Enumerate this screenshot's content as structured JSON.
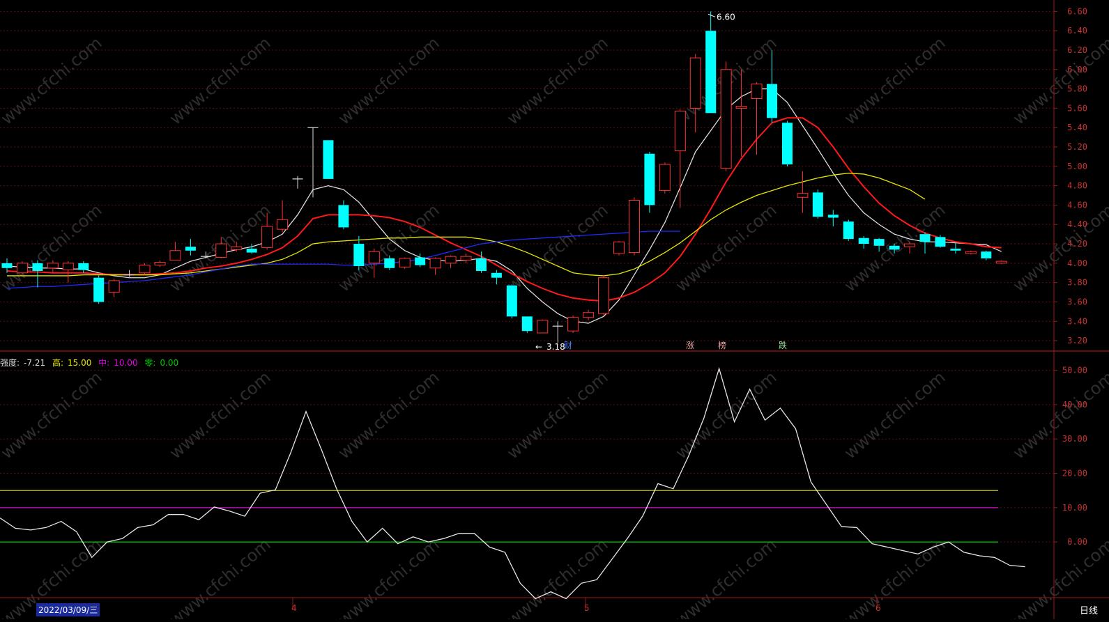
{
  "chart_data": {
    "type": "candlestick",
    "price_axis": {
      "ticks": [
        "6.60",
        "6.40",
        "6.20",
        "6.00",
        "5.80",
        "5.60",
        "5.40",
        "5.20",
        "5.00",
        "4.80",
        "4.60",
        "4.40",
        "4.20",
        "4.00",
        "3.80",
        "3.60",
        "3.40",
        "3.20"
      ],
      "range": [
        3.1,
        6.66
      ]
    },
    "candles": [
      {
        "o": 4.0,
        "c": 3.95,
        "h": 4.05,
        "l": 3.9
      },
      {
        "o": 3.9,
        "c": 4.0,
        "h": 4.02,
        "l": 3.88
      },
      {
        "o": 4.0,
        "c": 3.92,
        "h": 4.03,
        "l": 3.75
      },
      {
        "o": 3.95,
        "c": 4.0,
        "h": 4.03,
        "l": 3.9
      },
      {
        "o": 3.93,
        "c": 4.0,
        "h": 4.02,
        "l": 3.8
      },
      {
        "o": 4.0,
        "c": 3.93,
        "h": 4.02,
        "l": 3.9
      },
      {
        "o": 3.85,
        "c": 3.6,
        "h": 3.88,
        "l": 3.58
      },
      {
        "o": 3.7,
        "c": 3.82,
        "h": 3.84,
        "l": 3.65
      },
      {
        "o": 3.88,
        "c": 3.88,
        "h": 3.93,
        "l": 3.86
      },
      {
        "o": 3.9,
        "c": 3.98,
        "h": 4.0,
        "l": 3.88
      },
      {
        "o": 3.98,
        "c": 4.01,
        "h": 4.03,
        "l": 3.96
      },
      {
        "o": 4.03,
        "c": 4.13,
        "h": 4.22,
        "l": 4.03
      },
      {
        "o": 4.17,
        "c": 4.13,
        "h": 4.25,
        "l": 4.08
      },
      {
        "o": 4.07,
        "c": 4.07,
        "h": 4.12,
        "l": 4.05
      },
      {
        "o": 4.06,
        "c": 4.2,
        "h": 4.27,
        "l": 4.05
      },
      {
        "o": 4.14,
        "c": 4.17,
        "h": 4.22,
        "l": 4.12
      },
      {
        "o": 4.15,
        "c": 4.11,
        "h": 4.2,
        "l": 4.1
      },
      {
        "o": 4.16,
        "c": 4.38,
        "h": 4.52,
        "l": 4.14
      },
      {
        "o": 4.35,
        "c": 4.45,
        "h": 4.65,
        "l": 4.32
      },
      {
        "o": 4.87,
        "c": 4.87,
        "h": 4.9,
        "l": 4.77
      },
      {
        "o": 5.4,
        "c": 5.4,
        "h": 5.4,
        "l": 4.68
      },
      {
        "o": 5.27,
        "c": 4.87,
        "h": 5.27,
        "l": 4.87
      },
      {
        "o": 4.6,
        "c": 4.37,
        "h": 4.65,
        "l": 4.35
      },
      {
        "o": 4.2,
        "c": 3.97,
        "h": 4.28,
        "l": 3.93
      },
      {
        "o": 4.0,
        "c": 4.12,
        "h": 4.15,
        "l": 3.85
      },
      {
        "o": 4.05,
        "c": 3.95,
        "h": 4.08,
        "l": 3.93
      },
      {
        "o": 3.96,
        "c": 4.05,
        "h": 4.06,
        "l": 3.94
      },
      {
        "o": 4.06,
        "c": 3.98,
        "h": 4.1,
        "l": 3.96
      },
      {
        "o": 3.95,
        "c": 4.05,
        "h": 4.06,
        "l": 3.88
      },
      {
        "o": 4.0,
        "c": 4.07,
        "h": 4.08,
        "l": 3.95
      },
      {
        "o": 4.03,
        "c": 4.07,
        "h": 4.1,
        "l": 4.0
      },
      {
        "o": 4.05,
        "c": 3.92,
        "h": 4.12,
        "l": 3.9
      },
      {
        "o": 3.9,
        "c": 3.85,
        "h": 3.93,
        "l": 3.78
      },
      {
        "o": 3.77,
        "c": 3.45,
        "h": 3.78,
        "l": 3.43
      },
      {
        "o": 3.45,
        "c": 3.3,
        "h": 3.45,
        "l": 3.28
      },
      {
        "o": 3.28,
        "c": 3.41,
        "h": 3.42,
        "l": 3.28
      },
      {
        "o": 3.35,
        "c": 3.35,
        "h": 3.4,
        "l": 3.18
      },
      {
        "o": 3.3,
        "c": 3.44,
        "h": 3.46,
        "l": 3.28
      },
      {
        "o": 3.44,
        "c": 3.49,
        "h": 3.52,
        "l": 3.41
      },
      {
        "o": 3.48,
        "c": 3.85,
        "h": 3.88,
        "l": 3.45
      },
      {
        "o": 4.1,
        "c": 4.22,
        "h": 4.23,
        "l": 4.08
      },
      {
        "o": 4.11,
        "c": 4.65,
        "h": 4.68,
        "l": 4.08
      },
      {
        "o": 5.13,
        "c": 4.6,
        "h": 5.15,
        "l": 4.52
      },
      {
        "o": 4.75,
        "c": 5.02,
        "h": 5.04,
        "l": 4.72
      },
      {
        "o": 5.16,
        "c": 5.57,
        "h": 5.59,
        "l": 4.57
      },
      {
        "o": 5.6,
        "c": 6.12,
        "h": 6.16,
        "l": 5.35
      },
      {
        "o": 6.4,
        "c": 5.55,
        "h": 6.6,
        "l": 5.55
      },
      {
        "o": 4.98,
        "c": 6.0,
        "h": 6.08,
        "l": 4.95
      },
      {
        "o": 5.6,
        "c": 5.62,
        "h": 6.0,
        "l": 5.1
      },
      {
        "o": 5.7,
        "c": 5.85,
        "h": 5.87,
        "l": 5.12
      },
      {
        "o": 5.85,
        "c": 5.5,
        "h": 6.2,
        "l": 5.45
      },
      {
        "o": 5.45,
        "c": 5.02,
        "h": 5.47,
        "l": 5.0
      },
      {
        "o": 4.68,
        "c": 4.72,
        "h": 4.95,
        "l": 4.52
      },
      {
        "o": 4.73,
        "c": 4.48,
        "h": 4.76,
        "l": 4.46
      },
      {
        "o": 4.5,
        "c": 4.47,
        "h": 4.55,
        "l": 4.38
      },
      {
        "o": 4.43,
        "c": 4.25,
        "h": 4.45,
        "l": 4.23
      },
      {
        "o": 4.26,
        "c": 4.2,
        "h": 4.28,
        "l": 4.15
      },
      {
        "o": 4.25,
        "c": 4.18,
        "h": 4.26,
        "l": 4.12
      },
      {
        "o": 4.18,
        "c": 4.14,
        "h": 4.2,
        "l": 4.1
      },
      {
        "o": 4.17,
        "c": 4.2,
        "h": 4.22,
        "l": 4.1
      },
      {
        "o": 4.3,
        "c": 4.22,
        "h": 4.32,
        "l": 4.1
      },
      {
        "o": 4.27,
        "c": 4.17,
        "h": 4.29,
        "l": 4.16
      },
      {
        "o": 4.15,
        "c": 4.13,
        "h": 4.21,
        "l": 4.1
      },
      {
        "o": 4.1,
        "c": 4.12,
        "h": 4.13,
        "l": 4.09
      },
      {
        "o": 4.12,
        "c": 4.05,
        "h": 4.13,
        "l": 4.03
      },
      {
        "o": 4.0,
        "c": 4.02,
        "h": 4.03,
        "l": 3.99
      }
    ],
    "ma_lines": [
      {
        "color": "#dddddd",
        "values": [
          3.97,
          3.96,
          3.95,
          3.95,
          3.94,
          3.94,
          3.9,
          3.87,
          3.85,
          3.85,
          3.88,
          3.95,
          4.02,
          4.06,
          4.1,
          4.14,
          4.17,
          4.22,
          4.3,
          4.5,
          4.76,
          4.8,
          4.76,
          4.63,
          4.44,
          4.25,
          4.13,
          4.06,
          4.03,
          4.02,
          4.03,
          4.05,
          4.02,
          3.92,
          3.74,
          3.6,
          3.48,
          3.4,
          3.38,
          3.45,
          3.62,
          3.88,
          4.14,
          4.42,
          4.78,
          5.15,
          5.37,
          5.59,
          5.72,
          5.8,
          5.8,
          5.66,
          5.42,
          5.18,
          4.93,
          4.7,
          4.52,
          4.4,
          4.3,
          4.25,
          4.22,
          4.22,
          4.21,
          4.2,
          4.19,
          4.12
        ]
      },
      {
        "color": "#ff1a1a",
        "values": [
          3.92,
          3.91,
          3.91,
          3.9,
          3.9,
          3.9,
          3.89,
          3.88,
          3.88,
          3.88,
          3.89,
          3.9,
          3.92,
          3.95,
          3.97,
          4.0,
          4.04,
          4.09,
          4.16,
          4.28,
          4.46,
          4.5,
          4.5,
          4.5,
          4.49,
          4.47,
          4.43,
          4.37,
          4.29,
          4.21,
          4.14,
          4.07,
          3.98,
          3.89,
          3.81,
          3.74,
          3.68,
          3.64,
          3.62,
          3.61,
          3.64,
          3.7,
          3.79,
          3.9,
          4.07,
          4.3,
          4.56,
          4.84,
          5.08,
          5.28,
          5.45,
          5.5,
          5.5,
          5.4,
          5.2,
          4.98,
          4.79,
          4.62,
          4.49,
          4.39,
          4.31,
          4.26,
          4.22,
          4.2,
          4.17,
          4.16
        ]
      },
      {
        "color": "#e6e600",
        "values": [
          3.87,
          3.87,
          3.87,
          3.87,
          3.87,
          3.88,
          3.88,
          3.88,
          3.88,
          3.88,
          3.88,
          3.89,
          3.9,
          3.92,
          3.94,
          3.96,
          3.98,
          4.0,
          4.04,
          4.11,
          4.2,
          4.22,
          4.23,
          4.24,
          4.25,
          4.26,
          4.26,
          4.27,
          4.27,
          4.27,
          4.27,
          4.25,
          4.22,
          4.17,
          4.11,
          4.04,
          3.97,
          3.9,
          3.88,
          3.87,
          3.89,
          3.94,
          4.02,
          4.11,
          4.21,
          4.33,
          4.45,
          4.55,
          4.63,
          4.7,
          4.75,
          4.8,
          4.84,
          4.88,
          4.91,
          4.93,
          4.92,
          4.88,
          4.82,
          4.76,
          4.66
        ]
      },
      {
        "color": "#1e2cff",
        "values": [
          3.74,
          3.75,
          3.76,
          3.76,
          3.77,
          3.78,
          3.79,
          3.8,
          3.81,
          3.82,
          3.84,
          3.86,
          3.88,
          3.91,
          3.94,
          3.97,
          3.99,
          3.99,
          3.99,
          3.99,
          3.99,
          3.99,
          3.98,
          3.98,
          3.99,
          4.0,
          4.02,
          4.04,
          4.08,
          4.12,
          4.16,
          4.2,
          4.22,
          4.24,
          4.25,
          4.26,
          4.27,
          4.28,
          4.29,
          4.3,
          4.31,
          4.32,
          4.33,
          4.33,
          4.33
        ]
      }
    ],
    "price_annotations": [
      {
        "text": "6.60"
      },
      {
        "text": "3.18"
      }
    ],
    "event_markers": [
      {
        "text": "财",
        "color": "#4a7cff"
      },
      {
        "text": "涨",
        "color": "#e8a0a0"
      },
      {
        "text": "榜",
        "color": "#e8a0a0"
      },
      {
        "text": "跌",
        "color": "#a0e0a0"
      }
    ],
    "indicator": {
      "legend": {
        "main_label": "强度:",
        "main_value": "-7.21",
        "high_label": "高:",
        "high_value": "15.00",
        "mid_label": "中:",
        "mid_value": "10.00",
        "zero_label": "零:",
        "zero_value": "0.00"
      },
      "axis_ticks": [
        "50.00",
        "40.00",
        "30.00",
        "20.00",
        "10.00",
        "0.00"
      ],
      "range": [
        -16,
        55
      ],
      "levels": [
        {
          "value": 15,
          "color": "#e6e600"
        },
        {
          "value": 10,
          "color": "#e600e6"
        },
        {
          "value": 0,
          "color": "#00cc00"
        }
      ],
      "series": [
        7,
        4,
        3.5,
        4.2,
        6,
        3,
        -4.5,
        0,
        1,
        4.2,
        5,
        8,
        8,
        6.5,
        10.2,
        9,
        7.5,
        14.2,
        15.2,
        26,
        38,
        27,
        15.5,
        6,
        0,
        4,
        -0.5,
        1.5,
        0,
        1,
        2.5,
        2.5,
        -1.5,
        -3,
        -12,
        -16.5,
        -14.5,
        -16.5,
        -12,
        -11,
        -5,
        1,
        7.5,
        17,
        15.5,
        25,
        36,
        50.5,
        35,
        44.5,
        35.5,
        39,
        33,
        17.5,
        11,
        4.5,
        4.2,
        -0.5,
        -1.5,
        -2.5,
        -3.5,
        -1.5,
        0,
        -3,
        -4,
        -4.5,
        -6.8,
        -7.2
      ]
    },
    "xaxis": {
      "date_label": "2022/03/09/三",
      "months": [
        "4",
        "5",
        "6"
      ],
      "period": "日线"
    }
  },
  "watermark": "www.cfchi.com"
}
